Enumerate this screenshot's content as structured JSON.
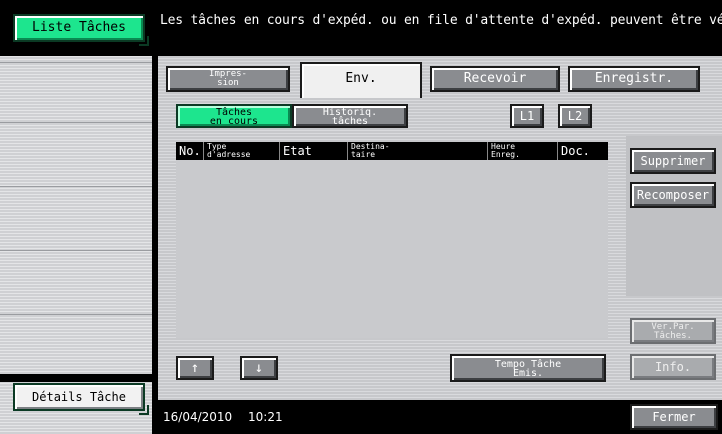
{
  "sidebar": {
    "liste_taches_label": "Liste Tâches",
    "details_tache_label": "Détails Tâche"
  },
  "message": "Les tâches en cours d'expéd. ou en file d'attente d'expéd. peuvent être vérif.",
  "tabs": [
    {
      "label": "Impres-\nsion"
    },
    {
      "label": "Env."
    },
    {
      "label": "Recevoir"
    },
    {
      "label": "Enregistr."
    }
  ],
  "subtabs": {
    "en_cours": "Tâches\nen cours",
    "historique": "Historiq.\ntâches",
    "l1": "L1",
    "l2": "L2"
  },
  "table": {
    "columns": [
      "No.",
      "Type\nd'adresse",
      "Etat",
      "Destina-\ntaire",
      "Heure\nEnreg.",
      "Doc."
    ]
  },
  "actions": {
    "supprimer": "Supprimer",
    "recomposer": "Recomposer",
    "ver_par_taches": "Ver.Par.\nTâches.",
    "info": "Info."
  },
  "scroll": {
    "up": "↑",
    "down": "↓"
  },
  "tempo_label": "Tempo Tâche\nEmis.",
  "status": {
    "date": "16/04/2010",
    "time": "10:21"
  },
  "fermer": "Fermer",
  "colors": {
    "accent_green": "#1de58e",
    "button_gray": "#8a8c90",
    "panel_bg": "#c9cacd"
  }
}
